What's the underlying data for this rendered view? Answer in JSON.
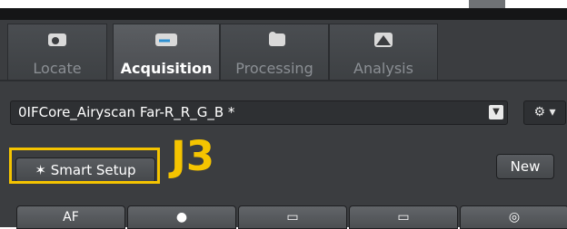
{
  "tabs": [
    {
      "label": "Locate",
      "icon": "locate-icon",
      "active": false
    },
    {
      "label": "Acquisition",
      "icon": "acquisition-icon",
      "active": true
    },
    {
      "label": "Processing",
      "icon": "processing-icon",
      "active": false
    },
    {
      "label": "Analysis",
      "icon": "analysis-icon",
      "active": false
    }
  ],
  "experiment_dropdown": {
    "value": "0IFCore_Airyscan Far-R_R_G_B *"
  },
  "buttons": {
    "smart_setup": "Smart Setup",
    "new": "New"
  },
  "annotation": {
    "label": "J3",
    "color": "#f5c400"
  },
  "bottom_tabs": [
    {
      "label": "AF",
      "icon": ""
    },
    {
      "label": "",
      "icon": "camera-icon"
    },
    {
      "label": "",
      "icon": "live-icon"
    },
    {
      "label": "",
      "icon": "continuous-icon"
    },
    {
      "label": "",
      "icon": "snap-icon"
    }
  ],
  "colors": {
    "background": "#3b3d40",
    "accent": "#f5c400"
  }
}
